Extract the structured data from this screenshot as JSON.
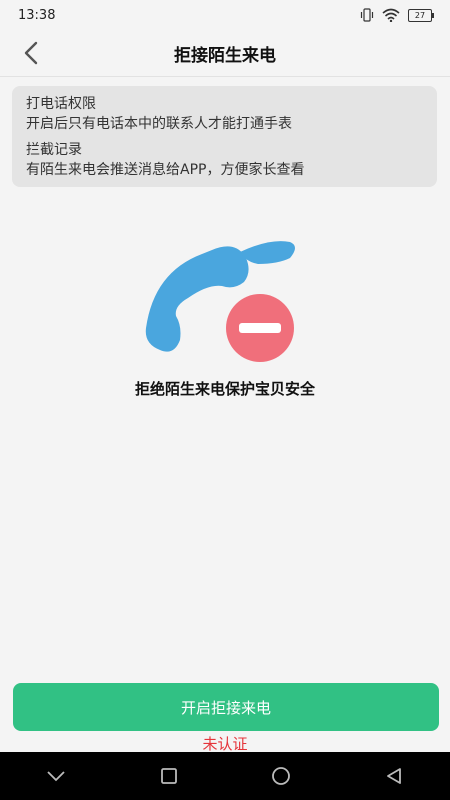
{
  "status_bar": {
    "time": "13:38",
    "battery": "27",
    "icons": [
      "vibrate-icon",
      "wifi-icon",
      "battery-icon"
    ]
  },
  "header": {
    "title": "拒接陌生来电",
    "back_icon": "chevron-left-icon"
  },
  "info": {
    "call_permission": {
      "title": "打电话权限",
      "desc": "开启后只有电话本中的联系人才能打通手表"
    },
    "intercept_record": {
      "title": "拦截记录",
      "desc": "有陌生来电会推送消息给APP，方便家长查看"
    }
  },
  "illustration": {
    "icon": "phone-blocked-icon",
    "phone_color": "#4aa6de",
    "block_color": "#f06f7b"
  },
  "slogan": "拒绝陌生来电保护宝贝安全",
  "action": {
    "button_label": "开启拒接来电",
    "button_color": "#31c184",
    "status": "未认证",
    "status_color": "#e5343a"
  },
  "system_nav": [
    "back-chevron-icon",
    "recents-icon",
    "home-icon",
    "back-triangle-icon"
  ]
}
